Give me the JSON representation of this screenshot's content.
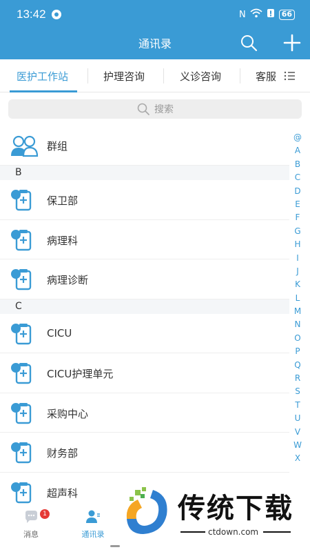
{
  "status_bar": {
    "time": "13:42",
    "battery": "66"
  },
  "header": {
    "title": "通讯录"
  },
  "tabs": [
    {
      "label": "医护工作站"
    },
    {
      "label": "护理咨询"
    },
    {
      "label": "义诊咨询"
    },
    {
      "label": "客服"
    }
  ],
  "search": {
    "placeholder": "搜索"
  },
  "contacts": {
    "group": {
      "label": "群组"
    },
    "sections": [
      {
        "letter": "B",
        "items": [
          "保卫部",
          "病理科",
          "病理诊断"
        ]
      },
      {
        "letter": "C",
        "items": [
          "CICU",
          "CICU护理单元",
          "采购中心",
          "财务部",
          "超声科"
        ]
      }
    ]
  },
  "alphabet_index": [
    "@",
    "A",
    "B",
    "C",
    "D",
    "E",
    "F",
    "G",
    "H",
    "I",
    "J",
    "K",
    "L",
    "M",
    "N",
    "O",
    "P",
    "Q",
    "R",
    "S",
    "T",
    "U",
    "V",
    "W",
    "X"
  ],
  "bottom_nav": {
    "messages": {
      "label": "消息",
      "badge": "1"
    },
    "contacts": {
      "label": "通讯录"
    }
  },
  "watermark": {
    "text": "传统下载",
    "url": "ctdown.com"
  },
  "colors": {
    "primary": "#3a9bd5",
    "badge": "#e53935",
    "divider": "#eeeeee"
  }
}
